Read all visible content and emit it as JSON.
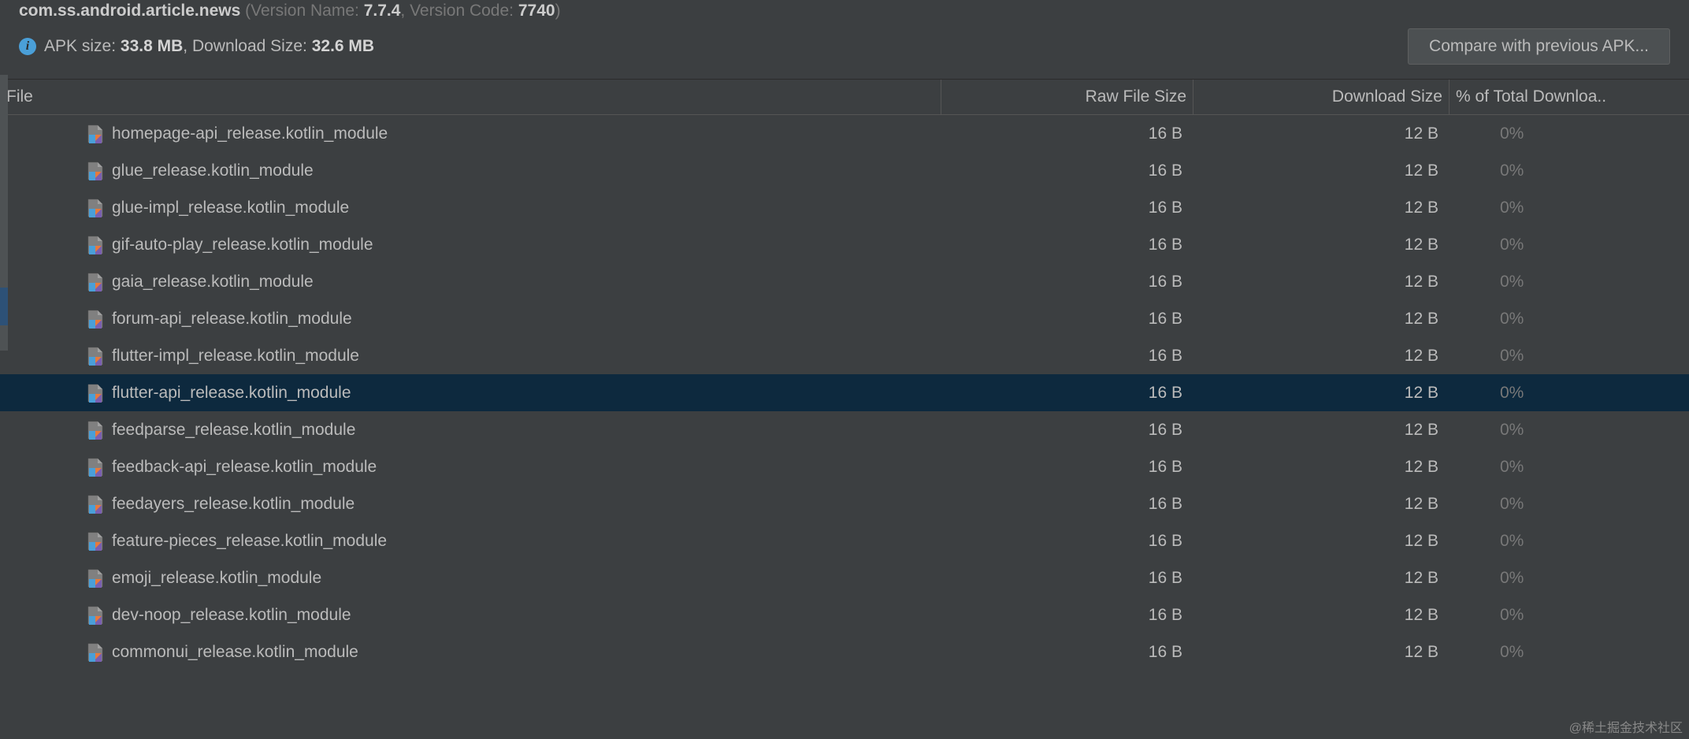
{
  "package": {
    "name": "com.ss.android.article.news",
    "version_name_label": "(Version Name:",
    "version_name": "7.7.4",
    "version_code_label": ", Version Code:",
    "version_code": "7740",
    "close": ")"
  },
  "apk_info": {
    "apk_size_label": "APK size:",
    "apk_size": "33.8 MB",
    "separator": ",",
    "download_size_label": "Download Size:",
    "download_size": "32.6 MB"
  },
  "compare_button": "Compare with previous APK...",
  "headers": {
    "file": "File",
    "raw": "Raw File Size",
    "download": "Download Size",
    "percent": "% of Total Downloa.."
  },
  "rows": [
    {
      "name": "homepage-api_release.kotlin_module",
      "raw": "16 B",
      "download": "12 B",
      "percent": "0%",
      "selected": false
    },
    {
      "name": "glue_release.kotlin_module",
      "raw": "16 B",
      "download": "12 B",
      "percent": "0%",
      "selected": false
    },
    {
      "name": "glue-impl_release.kotlin_module",
      "raw": "16 B",
      "download": "12 B",
      "percent": "0%",
      "selected": false
    },
    {
      "name": "gif-auto-play_release.kotlin_module",
      "raw": "16 B",
      "download": "12 B",
      "percent": "0%",
      "selected": false
    },
    {
      "name": "gaia_release.kotlin_module",
      "raw": "16 B",
      "download": "12 B",
      "percent": "0%",
      "selected": false
    },
    {
      "name": "forum-api_release.kotlin_module",
      "raw": "16 B",
      "download": "12 B",
      "percent": "0%",
      "selected": false
    },
    {
      "name": "flutter-impl_release.kotlin_module",
      "raw": "16 B",
      "download": "12 B",
      "percent": "0%",
      "selected": false
    },
    {
      "name": "flutter-api_release.kotlin_module",
      "raw": "16 B",
      "download": "12 B",
      "percent": "0%",
      "selected": true
    },
    {
      "name": "feedparse_release.kotlin_module",
      "raw": "16 B",
      "download": "12 B",
      "percent": "0%",
      "selected": false
    },
    {
      "name": "feedback-api_release.kotlin_module",
      "raw": "16 B",
      "download": "12 B",
      "percent": "0%",
      "selected": false
    },
    {
      "name": "feedayers_release.kotlin_module",
      "raw": "16 B",
      "download": "12 B",
      "percent": "0%",
      "selected": false
    },
    {
      "name": "feature-pieces_release.kotlin_module",
      "raw": "16 B",
      "download": "12 B",
      "percent": "0%",
      "selected": false
    },
    {
      "name": "emoji_release.kotlin_module",
      "raw": "16 B",
      "download": "12 B",
      "percent": "0%",
      "selected": false
    },
    {
      "name": "dev-noop_release.kotlin_module",
      "raw": "16 B",
      "download": "12 B",
      "percent": "0%",
      "selected": false
    },
    {
      "name": "commonui_release.kotlin_module",
      "raw": "16 B",
      "download": "12 B",
      "percent": "0%",
      "selected": false
    }
  ],
  "watermark": "@稀土掘金技术社区"
}
